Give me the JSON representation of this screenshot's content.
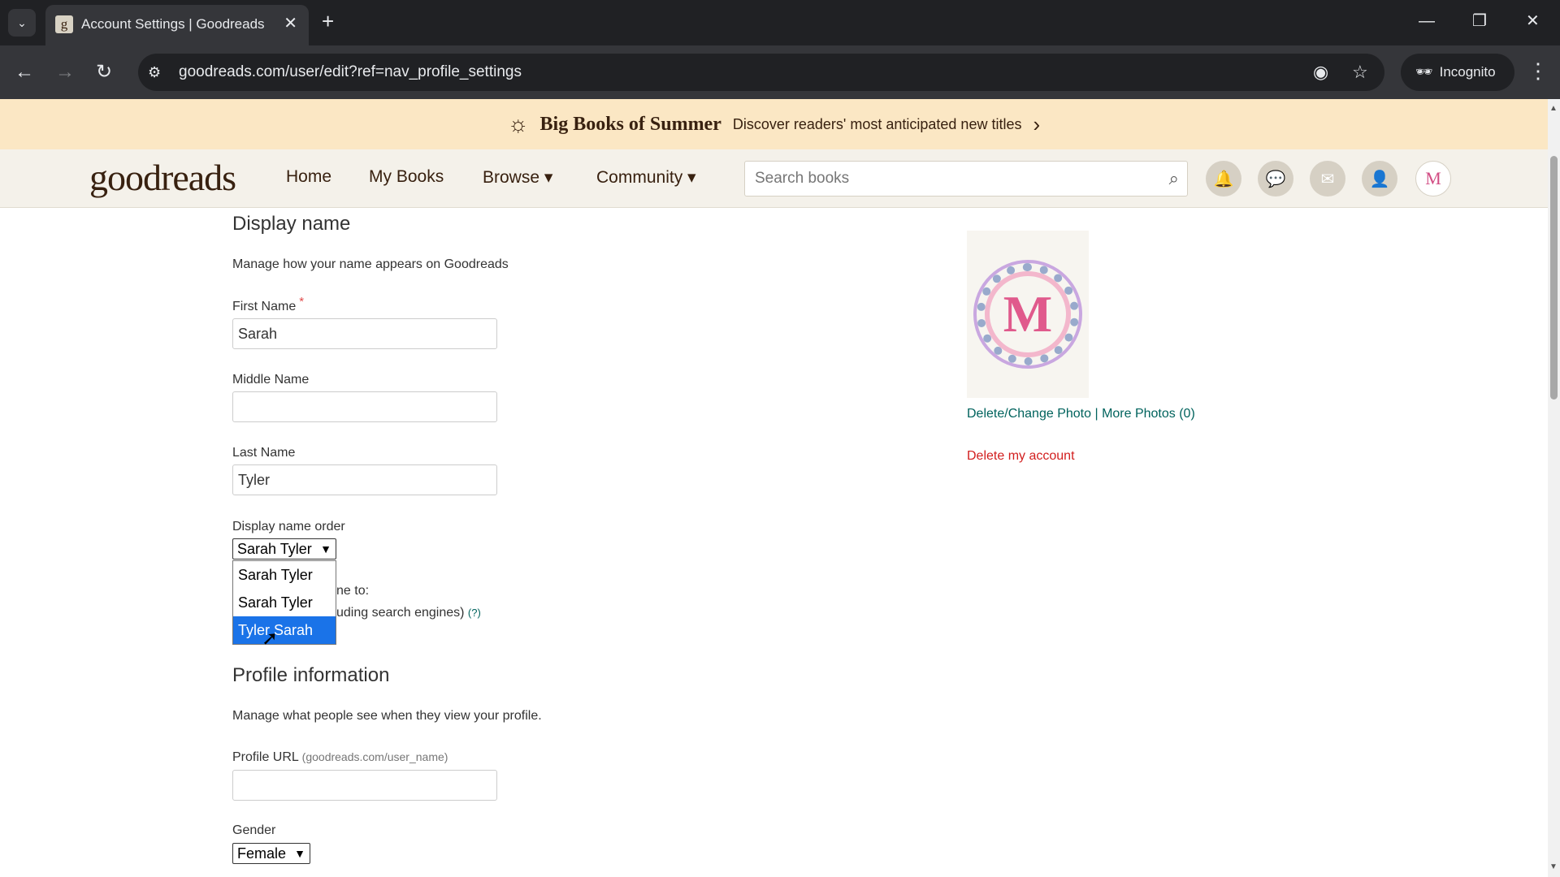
{
  "browser": {
    "tab_title": "Account Settings | Goodreads",
    "favicon_letter": "g",
    "url": "goodreads.com/user/edit?ref=nav_profile_settings",
    "incognito_label": "Incognito"
  },
  "promo": {
    "title": "Big Books of Summer",
    "text": "Discover readers' most anticipated new titles"
  },
  "header": {
    "logo": "goodreads",
    "nav": {
      "home": "Home",
      "my_books": "My Books",
      "browse": "Browse ▾",
      "community": "Community ▾"
    },
    "search_placeholder": "Search books",
    "avatar_letter": "M"
  },
  "display_name": {
    "title": "Display name",
    "description": "Manage how your name appears on Goodreads",
    "first_name_label": "First Name",
    "required_mark": "*",
    "first_name_value": "Sarah",
    "middle_name_label": "Middle Name",
    "middle_name_value": "",
    "last_name_label": "Last Name",
    "last_name_value": "Tyler",
    "order_label": "Display name order",
    "order_selected": "Sarah Tyler",
    "order_options": [
      "Sarah Tyler",
      "Sarah Tyler",
      "Tyler Sarah"
    ],
    "highlighted_option_index": 2,
    "behind_text_1": "ne to:",
    "behind_text_2": "uding search engines)",
    "help_mark": "(?)"
  },
  "profile_info": {
    "title": "Profile information",
    "description": "Manage what people see when they view your profile.",
    "profile_url_label": "Profile URL",
    "profile_url_hint": "(goodreads.com/user_name)",
    "profile_url_value": "",
    "gender_label": "Gender",
    "gender_selected": "Female"
  },
  "photo": {
    "monogram": "M",
    "delete_change": "Delete/Change Photo",
    "separator": "|",
    "more_photos": "More Photos (0)"
  },
  "delete_account": "Delete my account"
}
